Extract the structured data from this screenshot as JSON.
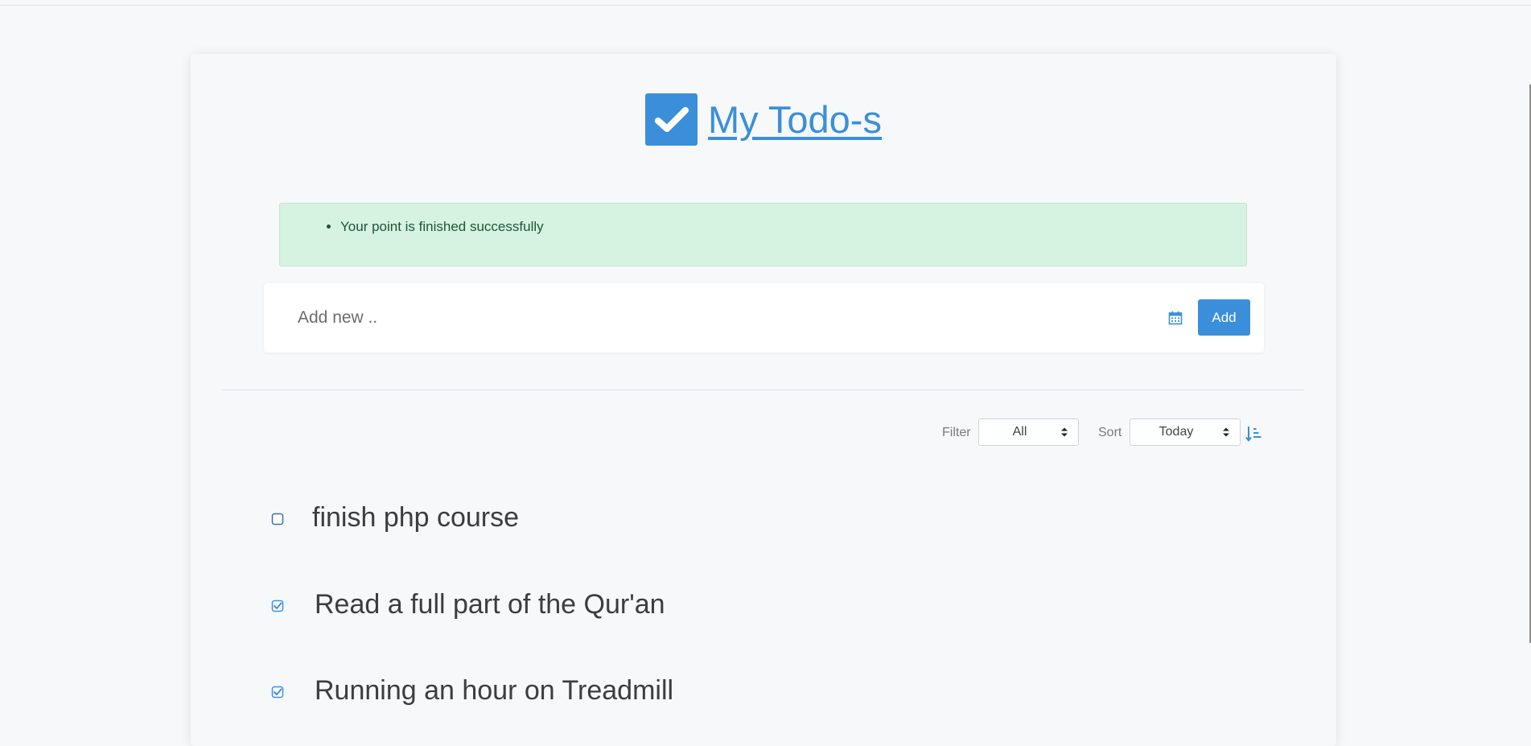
{
  "header": {
    "title": "My Todo-s",
    "logo_icon": "check-square-icon"
  },
  "alert": {
    "messages": [
      "Your point is finished successfully"
    ]
  },
  "add_form": {
    "placeholder": "Add new ..",
    "calendar_icon": "calendar-icon",
    "add_label": "Add"
  },
  "controls": {
    "filter_label": "Filter",
    "filter_value": "All",
    "sort_label": "Sort",
    "sort_value": "Today",
    "sort_icon": "sort-amount-asc-icon"
  },
  "todos": [
    {
      "text": "finish php course",
      "done": false
    },
    {
      "text": "Read a full part of the Qur'an",
      "done": true
    },
    {
      "text": "Running an hour on Treadmill",
      "done": true
    }
  ],
  "colors": {
    "accent": "#3b8fda",
    "alert_bg": "#d6f2e1",
    "alert_text": "#1e5632",
    "page_bg": "#f7f8fa"
  }
}
